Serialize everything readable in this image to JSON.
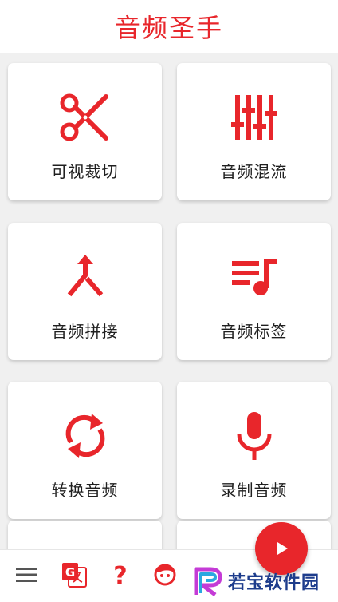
{
  "header": {
    "title": "音频圣手"
  },
  "tools": [
    {
      "label": "可视裁切",
      "icon": "scissors-icon"
    },
    {
      "label": "音频混流",
      "icon": "mixer-sliders-icon"
    },
    {
      "label": "音频拼接",
      "icon": "merge-arrows-icon"
    },
    {
      "label": "音频标签",
      "icon": "playlist-music-icon"
    },
    {
      "label": "转换音频",
      "icon": "sync-arrows-icon"
    },
    {
      "label": "录制音频",
      "icon": "microphone-icon"
    }
  ],
  "bottom_bar": {
    "items": [
      "menu-icon",
      "translate-icon",
      "help-icon",
      "face-icon"
    ],
    "fab_icon": "play-icon"
  },
  "watermark": {
    "text": "若宝软件园"
  },
  "colors": {
    "accent": "#e8262b",
    "background": "#f0f0f0",
    "card": "#ffffff"
  }
}
